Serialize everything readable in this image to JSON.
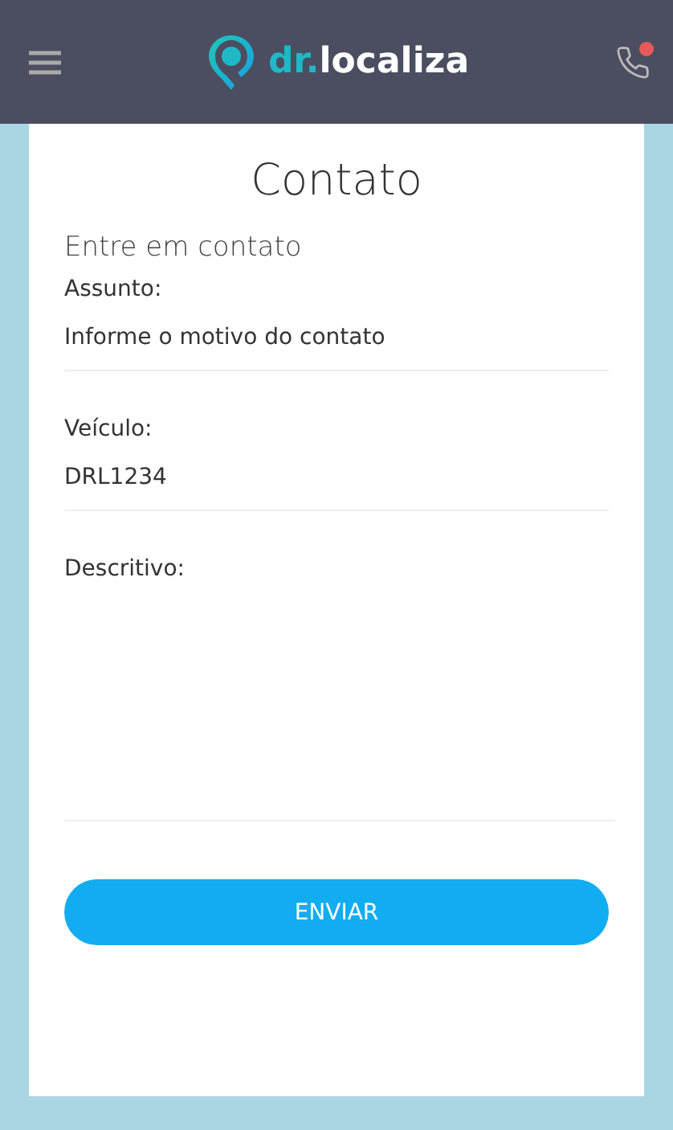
{
  "header": {
    "logo_prefix": "dr.",
    "logo_name": "localiza",
    "call_badge": true
  },
  "card": {
    "title": "Contato",
    "subtitle": "Entre em contato",
    "fields": [
      {
        "kind": "input",
        "label": "Assunto:",
        "placeholder": "Informe o motivo do contato"
      },
      {
        "kind": "input",
        "label": "Veículo:",
        "value": "DRL1234"
      },
      {
        "kind": "textarea",
        "label": "Descritivo:"
      }
    ],
    "submit": "ENVIAR"
  }
}
